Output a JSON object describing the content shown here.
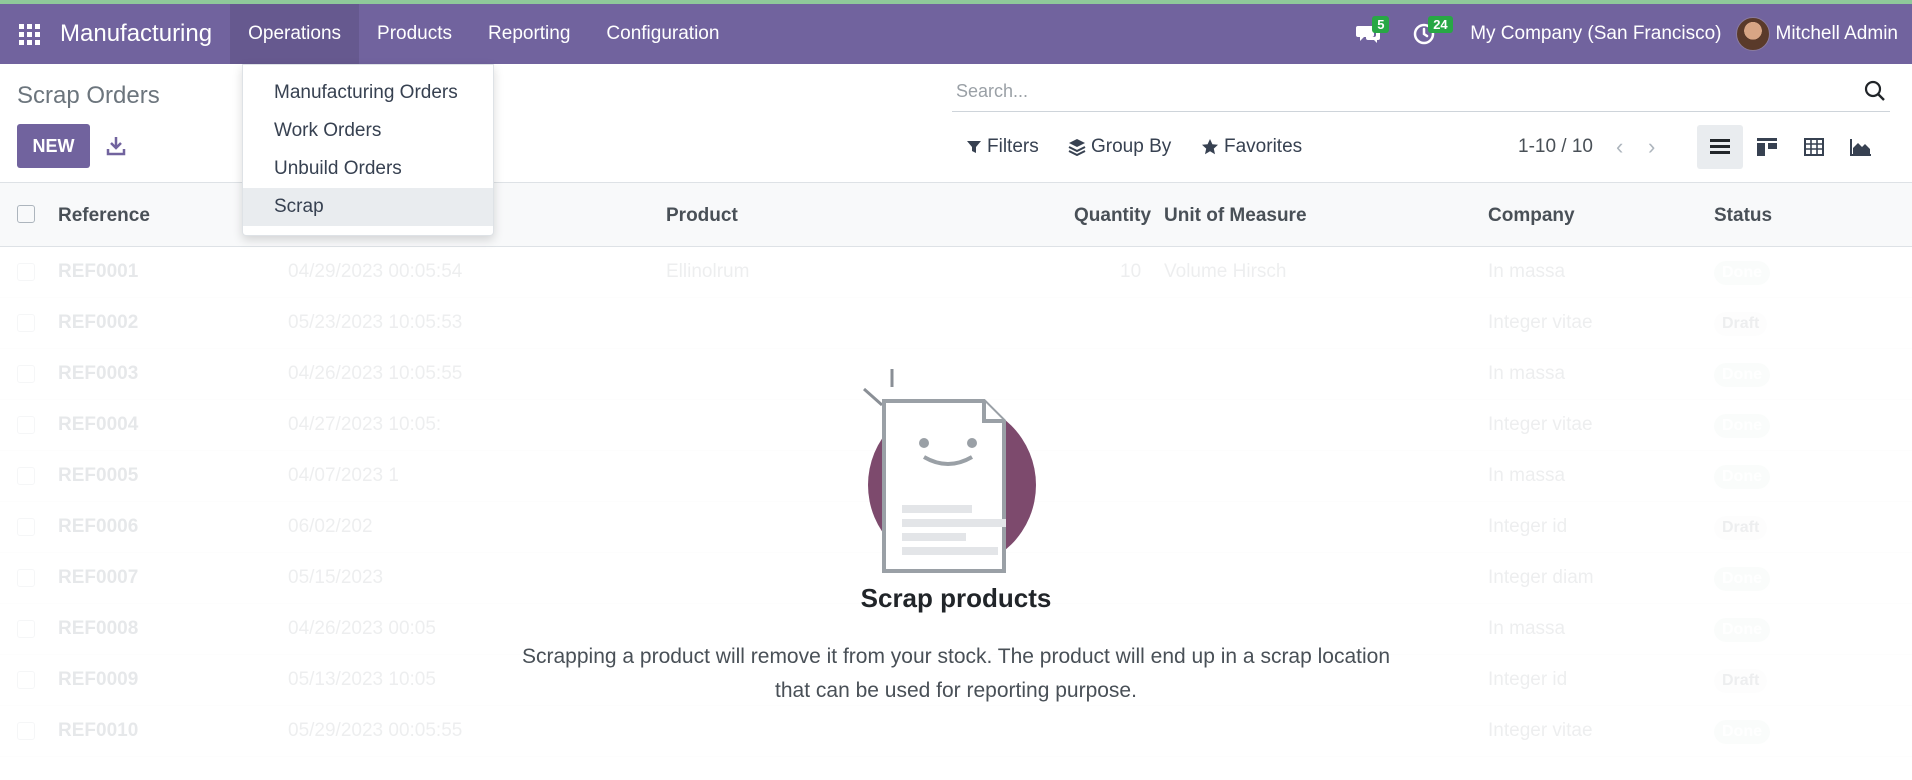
{
  "navbar": {
    "brand": "Manufacturing",
    "menu": [
      "Operations",
      "Products",
      "Reporting",
      "Configuration"
    ],
    "messages_count": "5",
    "activities_count": "24",
    "company": "My Company (San Francisco)",
    "user": "Mitchell Admin"
  },
  "dropdown": {
    "items": [
      "Manufacturing Orders",
      "Work Orders",
      "Unbuild Orders",
      "Scrap"
    ]
  },
  "control": {
    "title": "Scrap Orders",
    "new_label": "NEW",
    "search_placeholder": "Search...",
    "filters_label": "Filters",
    "groupby_label": "Group By",
    "favorites_label": "Favorites",
    "pager": "1-10 / 10"
  },
  "list": {
    "columns": [
      "Reference",
      "Product",
      "Quantity",
      "Unit of Measure",
      "Company",
      "Status"
    ],
    "rows": [
      {
        "ref": "REF0001",
        "date": "04/29/2023 00:05:54",
        "product": "Ellinolrum",
        "qty": "10",
        "uom": "Volume Hirsch",
        "company": "In massa",
        "status": "Done"
      },
      {
        "ref": "REF0002",
        "date": "05/23/2023 10:05:53",
        "product": "",
        "qty": "",
        "uom": "",
        "company": "Integer vitae",
        "status": "Draft"
      },
      {
        "ref": "REF0003",
        "date": "04/26/2023 10:05:55",
        "product": "",
        "qty": "",
        "uom": "",
        "company": "In massa",
        "status": "Done"
      },
      {
        "ref": "REF0004",
        "date": "04/27/2023 10:05:",
        "product": "",
        "qty": "",
        "uom": "",
        "company": "Integer vitae",
        "status": "Done"
      },
      {
        "ref": "REF0005",
        "date": "04/07/2023 1",
        "product": "",
        "qty": "",
        "uom": "",
        "company": "In massa",
        "status": "Done"
      },
      {
        "ref": "REF0006",
        "date": "06/02/202",
        "product": "",
        "qty": "",
        "uom": "",
        "company": "Integer id",
        "status": "Draft"
      },
      {
        "ref": "REF0007",
        "date": "05/15/2023",
        "product": "",
        "qty": "",
        "uom": "",
        "company": "Integer diam",
        "status": "Done"
      },
      {
        "ref": "REF0008",
        "date": "04/26/2023 00:05",
        "product": "",
        "qty": "",
        "uom": "",
        "company": "In massa",
        "status": "Done"
      },
      {
        "ref": "REF0009",
        "date": "05/13/2023 10:05",
        "product": "",
        "qty": "",
        "uom": "",
        "company": "Integer id",
        "status": "Draft"
      },
      {
        "ref": "REF0010",
        "date": "05/29/2023 00:05:55",
        "product": "",
        "qty": "",
        "uom": "",
        "company": "Integer vitae",
        "status": "Done"
      }
    ]
  },
  "help": {
    "title": "Scrap products",
    "text": "Scrapping a product will remove it from your stock. The product will end up in a scrap location that can be used for reporting purpose."
  },
  "colors": {
    "navbar": "#71639e",
    "primary_button": "#71639e",
    "badge": "#28a745"
  }
}
